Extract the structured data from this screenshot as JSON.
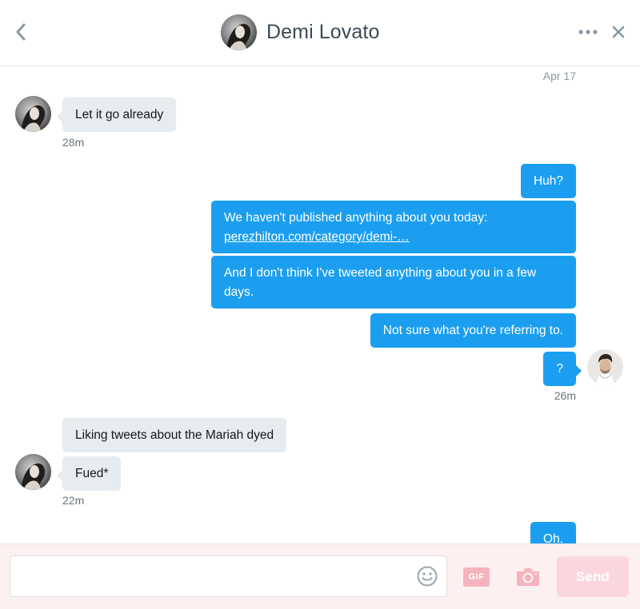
{
  "header": {
    "title": "Demi Lovato"
  },
  "conversation": {
    "date_stamp": "Apr 17",
    "messages": [
      {
        "from": "Demi Lovato",
        "text": "Let it go already",
        "time": "28m"
      },
      {
        "from": "me",
        "text": "Huh?"
      },
      {
        "from": "me",
        "text": "We haven't published anything about you today:",
        "link": "perezhilton.com/category/demi-…"
      },
      {
        "from": "me",
        "text_line1": "And I don't think I've tweeted anything about you in a few",
        "text_line2": "days."
      },
      {
        "from": "me",
        "text": "Not sure what you're referring to."
      },
      {
        "from": "me",
        "text": "?",
        "time": "26m"
      },
      {
        "from": "Demi Lovato",
        "text": "Liking tweets about the Mariah dyed"
      },
      {
        "from": "Demi Lovato",
        "text": "Fued*",
        "time": "22m"
      },
      {
        "from": "me",
        "text": "Oh."
      }
    ]
  },
  "composer": {
    "input_value": "",
    "input_placeholder": "",
    "gif_label": "GIF",
    "send_label": "Send"
  },
  "colors": {
    "sent_bubble": "#1b9ef0",
    "received_bubble": "#e6ecf0",
    "composer_bg": "#fdf0f0",
    "send_button": "#fbd7dd"
  },
  "icons": [
    "chevron-left-icon",
    "more-icon",
    "close-icon",
    "emoji-icon",
    "gif-icon",
    "camera-icon"
  ]
}
